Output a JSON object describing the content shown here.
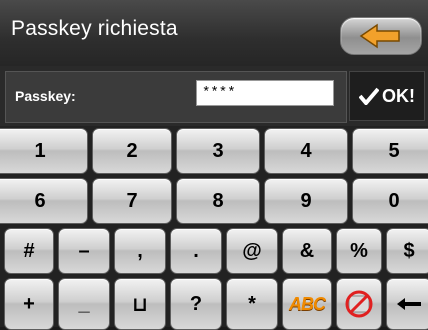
{
  "header": {
    "title": "Passkey richiesta",
    "back_icon": "back-arrow-icon"
  },
  "input_row": {
    "label": "Passkey:",
    "value": "****",
    "ok_label": "OK!",
    "ok_icon": "checkmark-icon"
  },
  "keyboard": {
    "row1": [
      "1",
      "2",
      "3",
      "4",
      "5"
    ],
    "row2": [
      "6",
      "7",
      "8",
      "9",
      "0"
    ],
    "row3": [
      "#",
      "–",
      ",",
      ".",
      "@",
      "&",
      "%",
      "$"
    ],
    "row4": {
      "plus": "+",
      "underscore": "_",
      "space": "⊔",
      "question": "?",
      "asterisk": "*",
      "abc": "ABC",
      "abc_icon": "abc-mode-icon",
      "no_edit_icon": "no-edit-icon",
      "backspace_icon": "backspace-arrow-icon"
    }
  }
}
